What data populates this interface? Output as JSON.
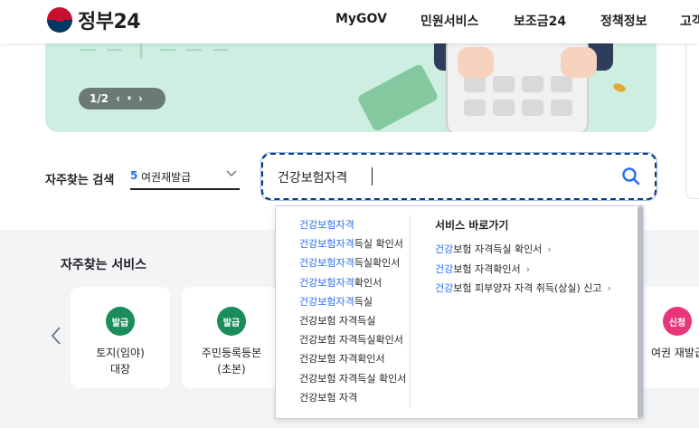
{
  "header": {
    "logo_text": "정부24",
    "nav": [
      "MyGOV",
      "민원서비스",
      "보조금24",
      "정책정보",
      "고객"
    ]
  },
  "banner": {
    "title_fragment": "ㅡ ㅡ ㅣ ㅡ ㅡ ㅡ",
    "pager": {
      "current": "1/2",
      "prev": "‹",
      "pause": "⏸",
      "next": "›"
    }
  },
  "search": {
    "label": "자주찾는 검색",
    "select_num": "5",
    "select_text": "여권재발급",
    "value": "건강보험자격"
  },
  "autocomplete": {
    "suggestions": [
      {
        "hl": "건강보험자격",
        "rest": ""
      },
      {
        "hl": "건강보험자격",
        "rest": "득실 확인서"
      },
      {
        "hl": "건강보험자격",
        "rest": "득실확인서"
      },
      {
        "hl": "건강보험자격",
        "rest": "확인서"
      },
      {
        "hl": "건강보험자격",
        "rest": "득실"
      },
      {
        "hl": "",
        "rest": "건강보험 자격득실"
      },
      {
        "hl": "",
        "rest": "건강보험 자격득실확인서"
      },
      {
        "hl": "",
        "rest": "건강보험 자격확인서"
      },
      {
        "hl": "",
        "rest": "건강보험 자격득실 확인서"
      },
      {
        "hl": "",
        "rest": "건강보험 자격"
      }
    ],
    "shortcut_title": "서비스 바로가기",
    "shortcuts": [
      {
        "hl": "건강",
        "rest": "보험 자격득실 확인서"
      },
      {
        "hl": "건강",
        "rest": "보험 자격확인서"
      },
      {
        "hl": "건강",
        "rest": "보험 피부양자 자격 취득(상실) 신고"
      }
    ],
    "arrow": "›"
  },
  "services": {
    "title": "자주찾는 서비스",
    "prev": "‹",
    "cards": [
      {
        "badge": "발급",
        "name1": "토지(임야)",
        "name2": "대장",
        "color": "#1a8d5b"
      },
      {
        "badge": "발급",
        "name1": "주민등록등본",
        "name2": "(초본)",
        "color": "#1a8d5b"
      },
      {
        "badge": "신청",
        "name1": "여권 재발급",
        "name2": "",
        "color": "#e9367b"
      }
    ]
  },
  "colors": {
    "accent": "#256ef4",
    "brand_blue": "#003764",
    "brand_red": "#c8102e"
  }
}
